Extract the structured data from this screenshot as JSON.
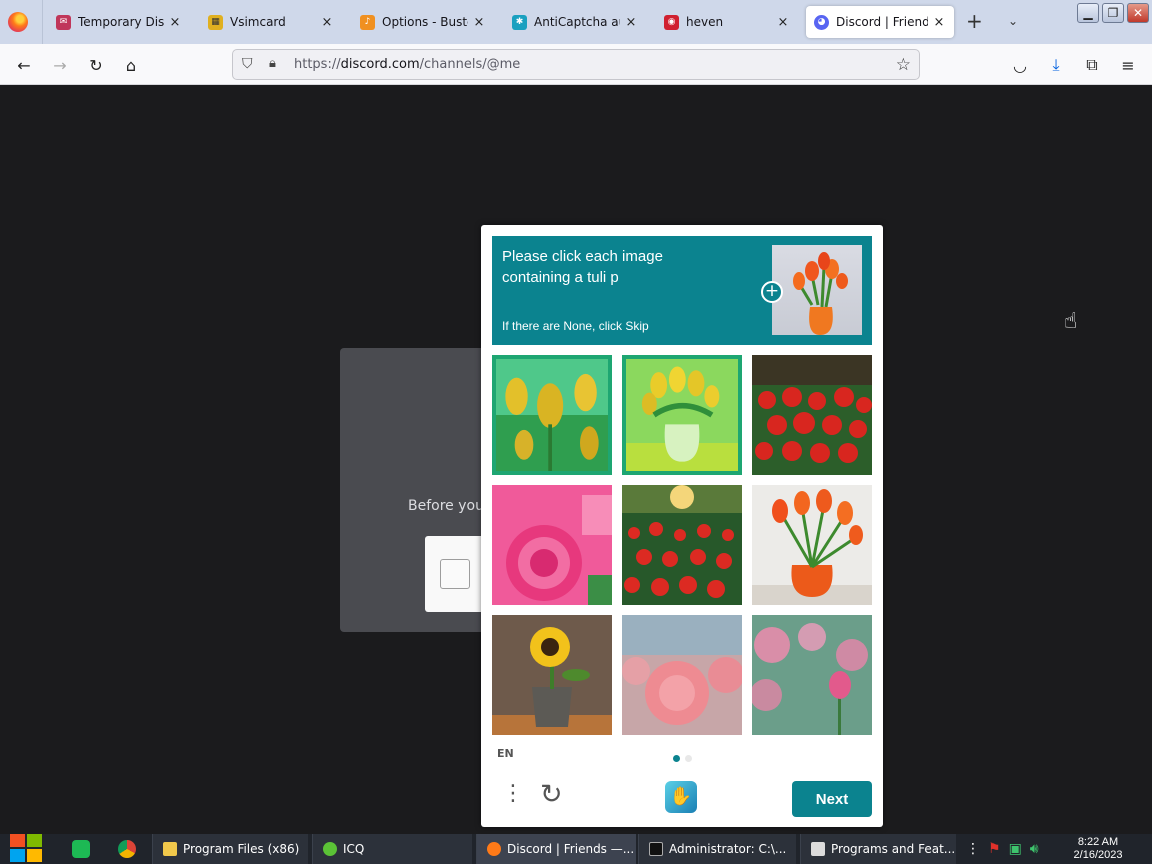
{
  "browser": {
    "tabs": [
      {
        "label": "Temporary Dispo",
        "icon": "mail-icon",
        "color": "#c0365a"
      },
      {
        "label": "Vsimcard",
        "icon": "sim-card-icon",
        "color": "#e0b020"
      },
      {
        "label": "Options - Buster",
        "icon": "buster-icon",
        "color": "#f09020"
      },
      {
        "label": "AntiCaptcha auto",
        "icon": "anticaptcha-icon",
        "color": "#1aa0c0"
      },
      {
        "label": "heven",
        "icon": "heven-icon",
        "color": "#d02030"
      },
      {
        "label": "Discord | Friends",
        "icon": "discord-icon",
        "color": "#5865f2"
      }
    ],
    "url_prefix": "https://",
    "url_domain": "discord.com",
    "url_path": "/channels/@me"
  },
  "page": {
    "background_text": "Before you"
  },
  "captcha": {
    "prompt_line1": "Please click each image",
    "prompt_line2": "containing a tuli p",
    "hint": "If there are None, click Skip",
    "example_label": "tulip-example",
    "images": [
      {
        "label": "yellow tulips field",
        "selected": true
      },
      {
        "label": "yellow tulips in vase",
        "selected": true
      },
      {
        "label": "red flowers",
        "selected": false
      },
      {
        "label": "pink rose",
        "selected": false
      },
      {
        "label": "red flower field",
        "selected": false
      },
      {
        "label": "orange tulips in vase",
        "selected": false
      },
      {
        "label": "sunflower in pot",
        "selected": false
      },
      {
        "label": "pink flowers blurred",
        "selected": false
      },
      {
        "label": "pink rose bud",
        "selected": false
      }
    ],
    "language": "EN",
    "page_index": 1,
    "page_count": 2,
    "next_label": "Next",
    "accent_color": "#0b838f",
    "selected_color": "#1ea672"
  },
  "taskbar": {
    "tasks": [
      {
        "label": "Program Files (x86)",
        "color": "#f1c84b"
      },
      {
        "label": "ICQ",
        "color": "#5bc236"
      },
      {
        "label": "Discord | Friends —...",
        "color": "#ff7a18"
      },
      {
        "label": "Administrator: C:\\...",
        "color": "#111111"
      },
      {
        "label": "Programs and Feat...",
        "color": "#dcdcdc"
      }
    ],
    "time": "8:22 AM",
    "date": "2/16/2023"
  }
}
